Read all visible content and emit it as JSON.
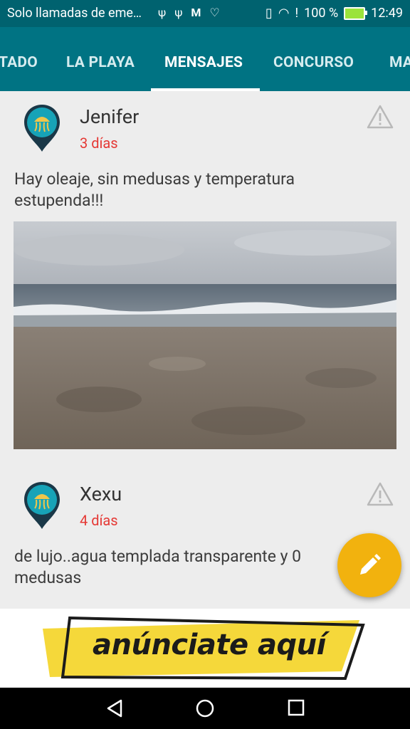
{
  "status_bar": {
    "notification_text": "Solo llamadas de eme…",
    "battery_percent": "100 %",
    "time": "12:49",
    "icons": [
      "usb-icon",
      "usb-icon",
      "gmail-icon",
      "health-icon",
      "vibrate-icon",
      "wifi-icon",
      "alert-icon",
      "battery-icon"
    ]
  },
  "tabs": [
    {
      "label": "TADO"
    },
    {
      "label": "LA PLAYA"
    },
    {
      "label": "MENSAJES",
      "active": true
    },
    {
      "label": "CONCURSO"
    },
    {
      "label": "MA"
    }
  ],
  "posts": [
    {
      "author": "Jenifer",
      "time": "3 días",
      "text": "Hay oleaje, sin medusas y temperatura estupenda!!!",
      "has_photo": true
    },
    {
      "author": "Xexu",
      "time": "4 días",
      "text": "de lujo..agua templada transparente y 0 medusas",
      "has_photo": false
    }
  ],
  "fab": {
    "icon": "pencil-icon"
  },
  "banner": {
    "text": "anúnciate aquí"
  },
  "colors": {
    "status_bar": "#00626f",
    "tab_bar": "#007383",
    "time_red": "#e53935",
    "fab": "#f2b20e",
    "banner_yellow": "#f5d83a"
  }
}
